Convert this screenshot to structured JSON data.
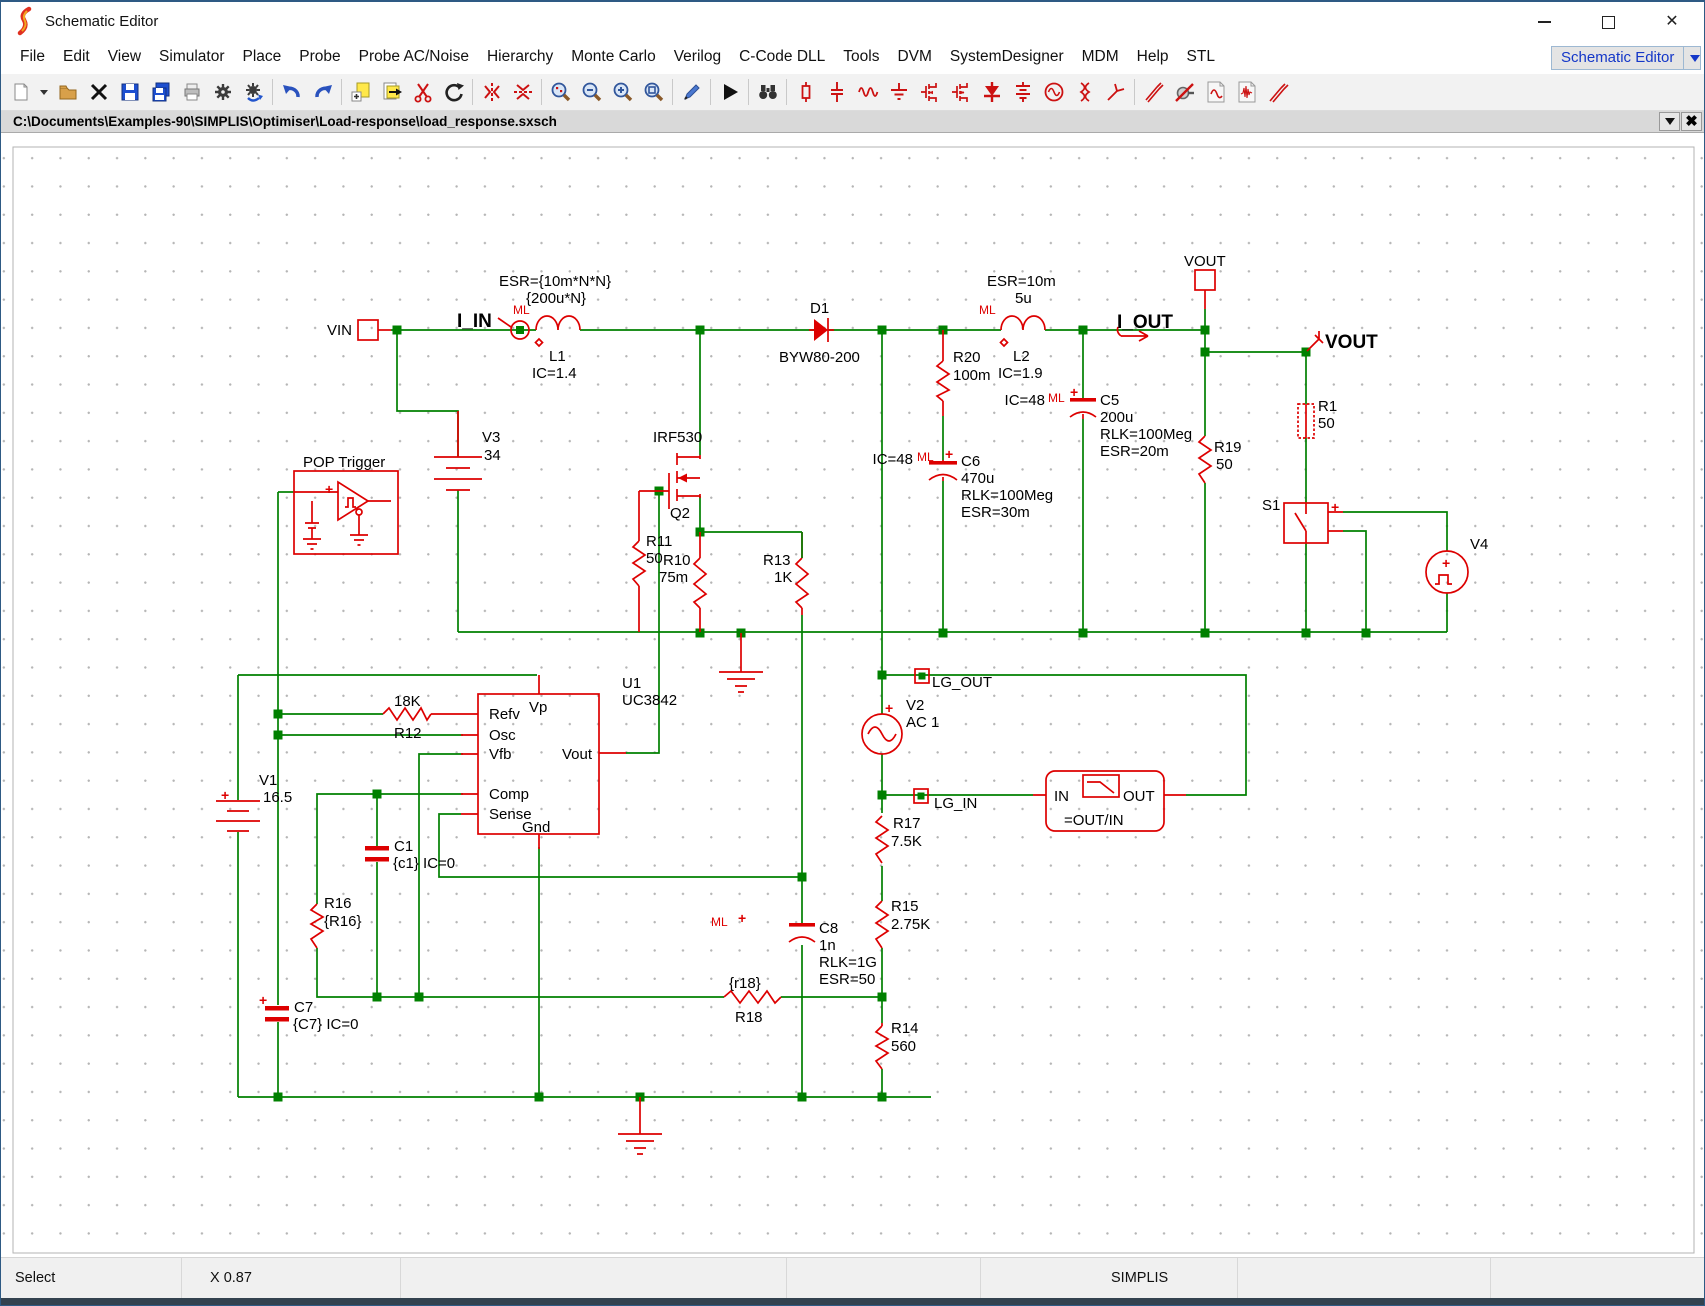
{
  "window": {
    "title": "Schematic Editor"
  },
  "menu": {
    "items": [
      "File",
      "Edit",
      "View",
      "Simulator",
      "Place",
      "Probe",
      "Probe AC/Noise",
      "Hierarchy",
      "Monte Carlo",
      "Verilog",
      "C-Code DLL",
      "Tools",
      "DVM",
      "SystemDesigner",
      "MDM",
      "Help",
      "STL"
    ],
    "context_selector": "Schematic Editor"
  },
  "toolbar": {
    "icons": [
      "new-schematic",
      "new-dropdown",
      "open-folder",
      "close-file",
      "save",
      "save-all",
      "print",
      "settings-gear",
      "simulator-gear",
      "undo",
      "redo",
      "copy-page",
      "export-page",
      "cut-scissors",
      "rotate",
      "mirror-vertical",
      "mirror-horizontal",
      "zoom-area",
      "zoom-out",
      "zoom-in",
      "zoom-extents",
      "wire-pencil",
      "run-simulation",
      "find-binoculars",
      "place-resistor",
      "place-capacitor",
      "place-inductor",
      "place-ground",
      "place-nmos",
      "place-pmos",
      "place-diode",
      "place-battery",
      "place-ac-source",
      "place-transformer",
      "place-terminal-pin",
      "voltage-probe",
      "gauge-probe",
      "ac-probe-doc",
      "transient-probe-doc",
      "diff-probe"
    ]
  },
  "pathbar": {
    "path": "C:\\Documents\\Examples-90\\SIMPLIS\\Optimiser\\Load-response\\load_response.sxsch"
  },
  "statusbar": {
    "mode": "Select",
    "coords": "X 0.87",
    "engine": "SIMPLIS"
  },
  "sch": {
    "plus": "+",
    "ml": "ML",
    "vin": "VIN",
    "i_in": "I_IN",
    "l1_esr": "ESR={10m*N*N}",
    "l1_val": "{200u*N}",
    "l1_name": "L1",
    "l1_ic": "IC=1.4",
    "v3_name": "V3",
    "v3_val": "34",
    "pop_title": "POP Trigger",
    "d1_name": "D1",
    "d1_val": "BYW80-200",
    "q2_model": "IRF530",
    "q2_name": "Q2",
    "r11_name": "R11",
    "r11_val": "50",
    "r10_name": "R10",
    "r10_val": "75m",
    "r13_name": "R13",
    "r13_val": "1K",
    "r20_name": "R20",
    "r20_val": "100m",
    "l2_esr": "ESR=10m",
    "l2_val": "5u",
    "l2_name": "L2",
    "l2_ic": "IC=1.9",
    "c6_ic": "IC=48",
    "c6_name": "C6",
    "c6_val": "470u",
    "c6_rlk": "RLK=100Meg",
    "c6_esr": "ESR=30m",
    "c5_ic": "IC=48",
    "c5_name": "C5",
    "c5_val": "200u",
    "c5_rlk": "RLK=100Meg",
    "c5_esr": "ESR=20m",
    "i_out": "I_OUT",
    "vout_term": "VOUT",
    "vout_probe": "VOUT",
    "r19_name": "R19",
    "r19_val": "50",
    "r1_name": "R1",
    "r1_val": "50",
    "s1_name": "S1",
    "v4_name": "V4",
    "u1_name": "U1",
    "u1_model": "UC3842",
    "pin_refv": "Refv",
    "pin_vp": "Vp",
    "pin_osc": "Osc",
    "pin_vfb": "Vfb",
    "pin_vout": "Vout",
    "pin_comp": "Comp",
    "pin_sense": "Sense",
    "pin_gnd": "Gnd",
    "r12_val": "18K",
    "r12_name": "R12",
    "v1_name": "V1",
    "v1_val": "16.5",
    "c1_name": "C1",
    "c1_val": "{c1} IC=0",
    "r16_name": "R16",
    "r16_val": "{R16}",
    "c7_name": "C7",
    "c7_val": "{C7} IC=0",
    "lg_out": "LG_OUT",
    "v2_name": "V2",
    "v2_val": "AC 1",
    "lg_in": "LG_IN",
    "r17_name": "R17",
    "r17_val": "7.5K",
    "r15_name": "R15",
    "r15_val": "2.75K",
    "c8_name": "C8",
    "c8_val": "1n",
    "c8_rlk": "RLK=1G",
    "c8_esr": "ESR=50",
    "r18_val": "{r18}",
    "r18_name": "R18",
    "r14_name": "R14",
    "r14_val": "560",
    "box_in": "IN",
    "box_out": "OUT",
    "box_expr": "=OUT/IN"
  }
}
